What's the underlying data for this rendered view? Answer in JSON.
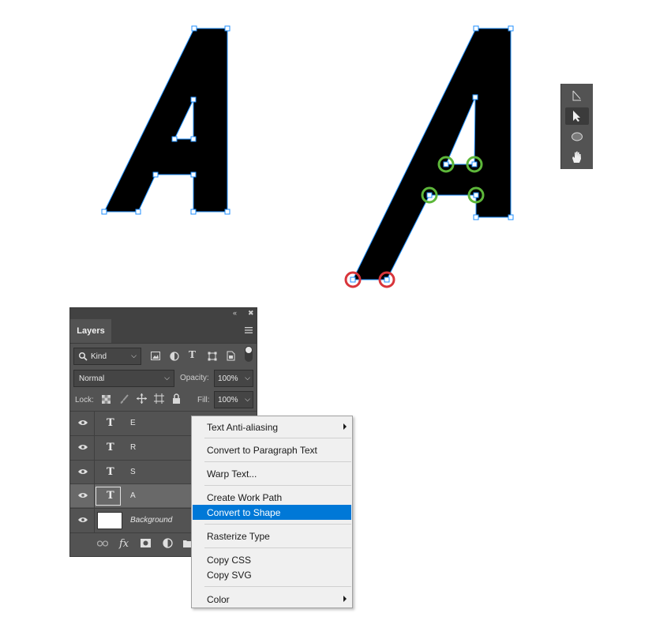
{
  "panel": {
    "tab_label": "Layers",
    "filter_kind": "Kind",
    "blend_mode": "Normal",
    "opacity_label": "Opacity:",
    "opacity_value": "100%",
    "lock_label": "Lock:",
    "fill_label": "Fill:",
    "fill_value": "100%",
    "layers": [
      {
        "name": "E",
        "type": "text",
        "selected": false
      },
      {
        "name": "R",
        "type": "text",
        "selected": false
      },
      {
        "name": "S",
        "type": "text",
        "selected": false
      },
      {
        "name": "A",
        "type": "text",
        "selected": true
      },
      {
        "name": "Background",
        "type": "image",
        "selected": false
      }
    ]
  },
  "context_menu": {
    "items": [
      {
        "label": "Text Anti-aliasing",
        "submenu": true
      },
      {
        "label": "Convert to Paragraph Text"
      },
      {
        "label": "Warp Text..."
      },
      {
        "label": "Create Work Path"
      },
      {
        "label": "Convert to Shape",
        "highlighted": true
      },
      {
        "label": "Rasterize Type"
      },
      {
        "label": "Copy CSS"
      },
      {
        "label": "Copy SVG"
      },
      {
        "label": "Color",
        "submenu": true
      }
    ]
  },
  "toolbox": {
    "tools": [
      "path-selection-icon",
      "direct-selection-icon",
      "ellipse-tool-icon",
      "hand-tool-icon"
    ]
  },
  "colors": {
    "panel_bg": "#535353",
    "menu_highlight": "#0078d7",
    "anchor_blue": "#1f8fff",
    "marker_green": "#5db73a",
    "marker_red": "#d8353b"
  }
}
